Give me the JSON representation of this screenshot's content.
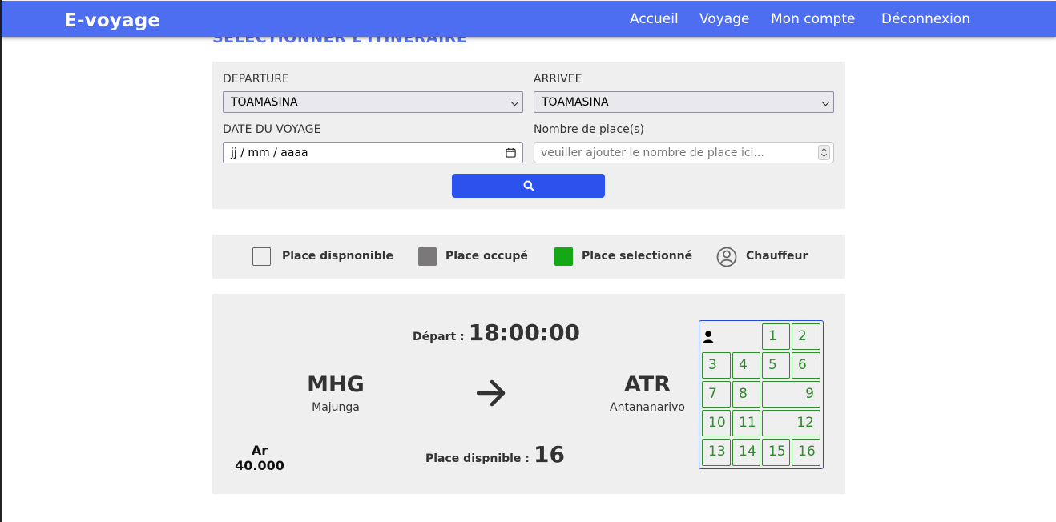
{
  "navbar": {
    "brand": "E-voyage",
    "links": [
      "Accueil",
      "Voyage",
      "Mon compte",
      "Déconnexion"
    ]
  },
  "page": {
    "section_title": "SELECTIONNER L'ITINERAIRE"
  },
  "search_form": {
    "departure_label": "DEPARTURE",
    "departure_value": "TOAMASINA",
    "arrival_label": "ARRIVEE",
    "arrival_value": "TOAMASINA",
    "date_label": "DATE DU VOYAGE",
    "date_value": "jj / mm / aaaa",
    "places_label": "Nombre de place(s)",
    "places_placeholder": "veuiller ajouter le nombre de place ici...",
    "search_icon": "search-icon"
  },
  "legend": {
    "available": "Place dispnonible",
    "occupied": "Place occupé",
    "selected": "Place selectionné",
    "driver": "Chauffeur",
    "colors": {
      "available_border": "#2e8b2e",
      "occupied": "#7a7878",
      "selected": "#14a814"
    }
  },
  "trip": {
    "depart_label": "Départ :",
    "depart_time": "18:00:00",
    "from_code": "MHG",
    "from_city": "Majunga",
    "to_code": "ATR",
    "to_city": "Antananarivo",
    "price_currency": "Ar",
    "price_amount": "40.000",
    "places_label": "Place dispnible :",
    "places_count": "16"
  },
  "seats": [
    "1",
    "2",
    "3",
    "4",
    "5",
    "6",
    "7",
    "8",
    "9",
    "10",
    "11",
    "12",
    "13",
    "14",
    "15",
    "16"
  ],
  "colors": {
    "navbar": "#4e6ef2",
    "button": "#2b52ec",
    "panel": "#efefef"
  }
}
